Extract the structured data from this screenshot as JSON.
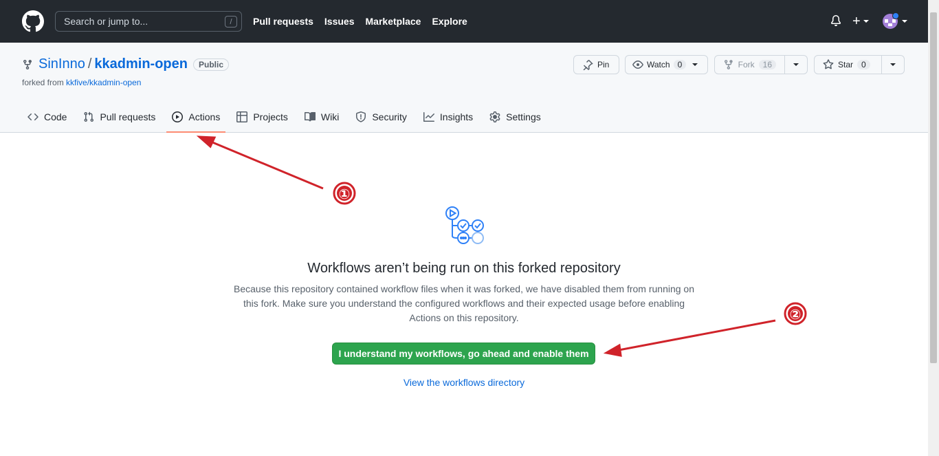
{
  "header": {
    "search_placeholder": "Search or jump to...",
    "search_shortcut": "/",
    "nav": [
      "Pull requests",
      "Issues",
      "Marketplace",
      "Explore"
    ],
    "plus_label": "+"
  },
  "repo": {
    "owner": "SinInno",
    "separator": "/",
    "name": "kkadmin-open",
    "visibility": "Public",
    "forked_from_prefix": "forked from",
    "forked_from_link": "kkfive/kkadmin-open",
    "pin_label": "Pin",
    "watch_label": "Watch",
    "watch_count": "0",
    "fork_label": "Fork",
    "fork_count": "16",
    "star_label": "Star",
    "star_count": "0"
  },
  "tabs": [
    {
      "label": "Code",
      "icon": "code-icon"
    },
    {
      "label": "Pull requests",
      "icon": "pull-request-icon"
    },
    {
      "label": "Actions",
      "icon": "play-icon",
      "active": true
    },
    {
      "label": "Projects",
      "icon": "table-icon"
    },
    {
      "label": "Wiki",
      "icon": "book-icon"
    },
    {
      "label": "Security",
      "icon": "shield-icon"
    },
    {
      "label": "Insights",
      "icon": "graph-icon"
    },
    {
      "label": "Settings",
      "icon": "gear-icon"
    }
  ],
  "blank_state": {
    "title": "Workflows aren’t being run on this forked repository",
    "description": "Because this repository contained workflow files when it was forked, we have disabled them from running on this fork. Make sure you understand the configured workflows and their expected usage before enabling Actions on this repository.",
    "enable_button": "I understand my workflows, go ahead and enable them",
    "view_link": "View the workflows directory"
  },
  "annotations": {
    "marker_1": "①",
    "marker_2": "②",
    "color": "#d0232a"
  },
  "colors": {
    "header_bg": "#24292f",
    "link": "#0969da",
    "primary_button": "#2da44e",
    "active_tab_underline": "#fd8c73"
  }
}
